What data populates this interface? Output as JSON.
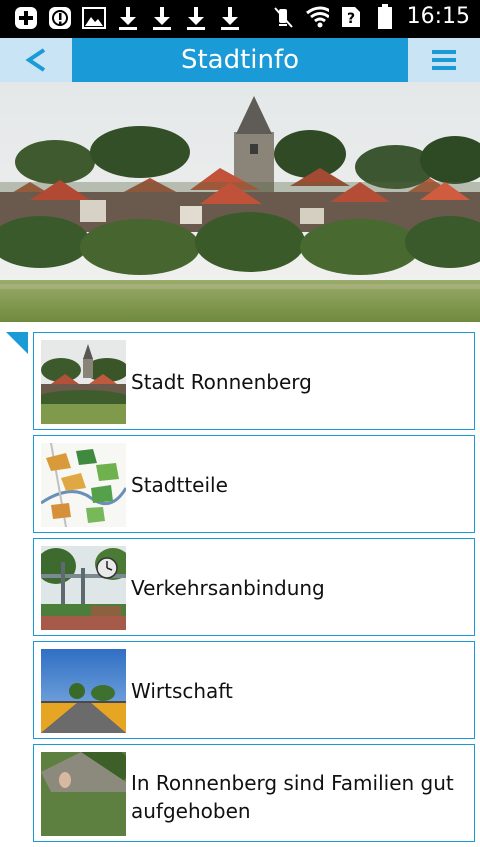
{
  "status_bar": {
    "time": "16:15",
    "icons": [
      "add-icon",
      "info-icon",
      "image-icon",
      "download-icon",
      "download-icon",
      "download-icon",
      "download-icon",
      "mute-icon",
      "wifi-icon",
      "sim-unknown-icon",
      "battery-icon"
    ]
  },
  "app_bar": {
    "back_label": "<",
    "title": "Stadtinfo",
    "menu_icon": "hamburger-menu-icon"
  },
  "colors": {
    "accent": "#1a9ad6",
    "button_bg": "#c8e4f5"
  },
  "items": [
    {
      "label": "Stadt Ronnenberg",
      "thumb": "town-photo"
    },
    {
      "label": "Stadtteile",
      "thumb": "district-map"
    },
    {
      "label": "Verkehrsanbindung",
      "thumb": "train-station-photo"
    },
    {
      "label": "Wirtschaft",
      "thumb": "road-photo"
    },
    {
      "label": "In Ronnenberg sind Familien gut aufgehoben",
      "thumb": "family-photo"
    }
  ]
}
